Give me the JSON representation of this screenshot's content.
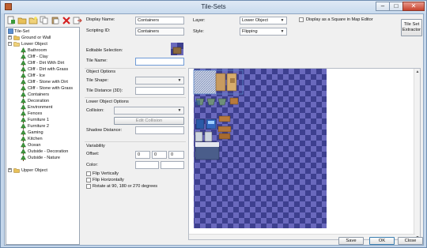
{
  "window": {
    "title": "Tile-Sets"
  },
  "toolbar": {
    "buttons": [
      {
        "name": "add-tile-set-button",
        "icon": "page-plus-icon"
      },
      {
        "name": "open-folder-button",
        "icon": "folder-icon"
      },
      {
        "name": "new-folder-button",
        "icon": "folder-new-icon"
      },
      {
        "name": "copy-button",
        "icon": "copy-icon"
      },
      {
        "name": "paste-button",
        "icon": "paste-icon"
      },
      {
        "name": "delete-button",
        "icon": "delete-x-icon"
      },
      {
        "name": "export-button",
        "icon": "export-icon"
      }
    ]
  },
  "tree": {
    "root": "Tile-Set",
    "groups": {
      "ground": "Ground or Wall",
      "lower": "Lower Object",
      "upper": "Upper Object"
    },
    "lower_children": [
      "Bathroom",
      "Cliff - Clay",
      "Cliff - Dirt With Dirt",
      "Cliff - Dirt with Grass",
      "Cliff - Ice",
      "Cliff - Stone with Dirt",
      "Cliff - Stone with Grass",
      "Containers",
      "Decoration",
      "Environment",
      "Fences",
      "Furniture 1",
      "Furniture 2",
      "Gaming",
      "Kitchen",
      "Ocean",
      "Outside - Decoration",
      "Outside - Nature"
    ]
  },
  "props": {
    "display_name_label": "Display Name:",
    "display_name_value": "Containers",
    "scripting_id_label": "Scripting ID:",
    "scripting_id_value": "Containers",
    "editable_selection_label": "Editable Selection:",
    "tile_name_label": "Tile Name:",
    "tile_name_value": "",
    "object_options_header": "Object Options",
    "tile_shape_label": "Tile Shape:",
    "tile_distance_label": "Tile Distance (3D):",
    "lower_object_options_header": "Lower Object Options",
    "collision_label": "Collision:",
    "edit_collision_button": "Edit Collision",
    "shadow_distance_label": "Shadow Distance:",
    "variability_header": "Variability",
    "offset_label": "Offset:",
    "offset_values": [
      "0",
      "0",
      "0"
    ],
    "color_label": "Color:",
    "flip_vertically": "Flip Vertically",
    "flip_horizontally": "Flip Horizontally",
    "rotate": "Rotate at 90, 180 or 270 degrees"
  },
  "layer": {
    "label": "Layer:",
    "value": "Lower Object",
    "style_label": "Style:",
    "style_value": "Flipping",
    "display_square_label": "Display as a Square in Map Editor",
    "extractor_button": "Tile Set Extractor"
  },
  "footer": {
    "save": "Save",
    "ok": "OK",
    "close": "Close"
  },
  "colors": {
    "checker_dark": "#3d3f8f",
    "checker_light": "#6a69bd",
    "selection_blue": "#5b86c9"
  }
}
